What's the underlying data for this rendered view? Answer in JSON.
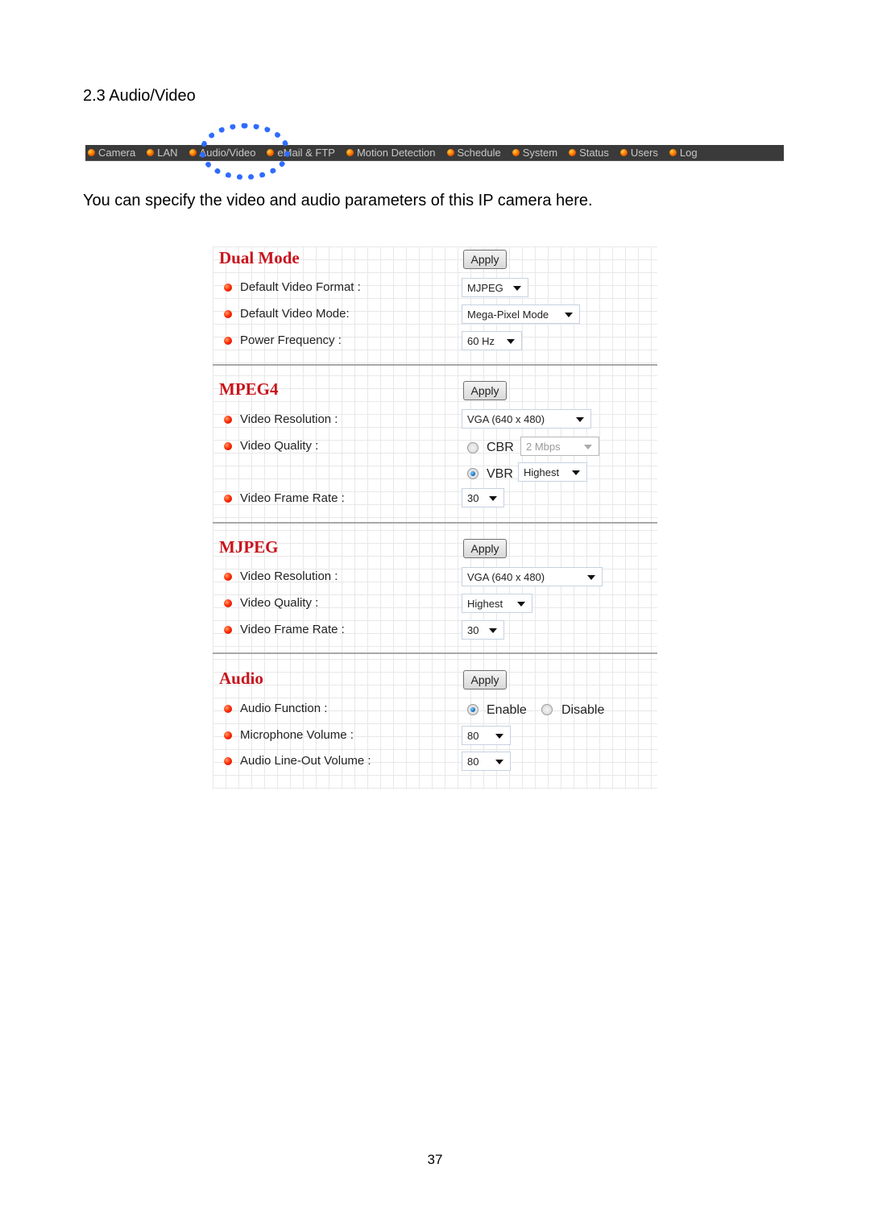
{
  "heading": "2.3 Audio/Video",
  "intro": "You can specify the video and audio parameters of this IP camera here.",
  "page_number": "37",
  "nav": {
    "active": "Audio/Video",
    "items": [
      "Camera",
      "LAN",
      "Audio/Video",
      "eMail & FTP",
      "Motion Detection",
      "Schedule",
      "System",
      "Status",
      "Users",
      "Log"
    ]
  },
  "colors": {
    "section_title": "#c8141c",
    "highlight": "#2f6bff",
    "navbar": "#3a3a3a"
  },
  "sections": {
    "dual_mode": {
      "title": "Dual Mode",
      "apply": "Apply",
      "rows": [
        {
          "label": "Default Video Format :",
          "value": "MJPEG"
        },
        {
          "label": "Default Video Mode:",
          "value": "Mega-Pixel Mode"
        },
        {
          "label": "Power Frequency :",
          "value": "60 Hz"
        }
      ]
    },
    "mpeg4": {
      "title": "MPEG4",
      "apply": "Apply",
      "resolution": {
        "label": "Video Resolution :",
        "value": "VGA (640 x 480)"
      },
      "quality": {
        "label": "Video Quality :",
        "cbr": {
          "label": "CBR",
          "value": "2 Mbps",
          "checked": false
        },
        "vbr": {
          "label": "VBR",
          "value": "Highest",
          "checked": true
        }
      },
      "frame_rate": {
        "label": "Video Frame Rate :",
        "value": "30"
      }
    },
    "mjpeg": {
      "title": "MJPEG",
      "apply": "Apply",
      "rows": [
        {
          "label": "Video Resolution :",
          "value": "VGA (640 x 480)"
        },
        {
          "label": "Video Quality :",
          "value": "Highest"
        },
        {
          "label": "Video Frame Rate :",
          "value": "30"
        }
      ]
    },
    "audio": {
      "title": "Audio",
      "apply": "Apply",
      "function": {
        "label": "Audio Function :",
        "enable": "Enable",
        "disable": "Disable",
        "selected": "Enable"
      },
      "mic": {
        "label": "Microphone Volume :",
        "value": "80"
      },
      "lineout": {
        "label": "Audio Line-Out Volume :",
        "value": "80"
      }
    }
  }
}
